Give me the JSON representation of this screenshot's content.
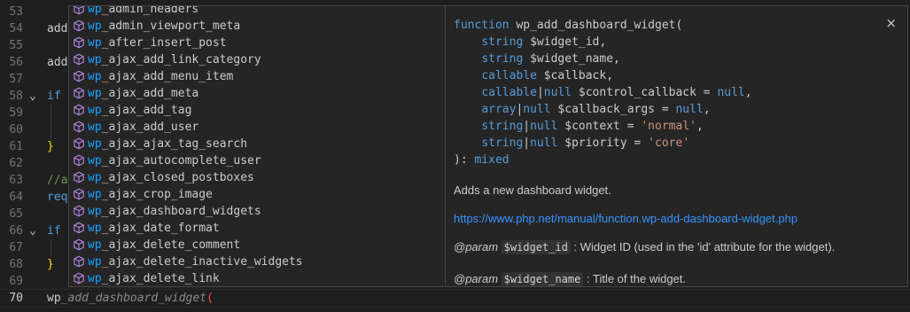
{
  "editor": {
    "lines": [
      {
        "num": "53",
        "code": ""
      },
      {
        "num": "54",
        "code": "add"
      },
      {
        "num": "55",
        "code": ""
      },
      {
        "num": "56",
        "code": "add"
      },
      {
        "num": "57",
        "code": ""
      },
      {
        "num": "58",
        "code": "if"
      },
      {
        "num": "59",
        "code": ""
      },
      {
        "num": "60",
        "code": ""
      },
      {
        "num": "61",
        "code": "}"
      },
      {
        "num": "62",
        "code": ""
      },
      {
        "num": "63",
        "code": "//a"
      },
      {
        "num": "64",
        "code": "req"
      },
      {
        "num": "65",
        "code": ""
      },
      {
        "num": "66",
        "code": "if"
      },
      {
        "num": "67",
        "code": ""
      },
      {
        "num": "68",
        "code": "}"
      },
      {
        "num": "69",
        "code": ""
      },
      {
        "num": "70",
        "code": "wp"
      }
    ],
    "current_line_ghost": "_add_dashboard_widget",
    "current_line_bracket": "("
  },
  "suggest": {
    "typed_prefix": "wp",
    "items": [
      "wp_admin_headers",
      "wp_admin_viewport_meta",
      "wp_after_insert_post",
      "wp_ajax_add_link_category",
      "wp_ajax_add_menu_item",
      "wp_ajax_add_meta",
      "wp_ajax_add_tag",
      "wp_ajax_add_user",
      "wp_ajax_ajax_tag_search",
      "wp_ajax_autocomplete_user",
      "wp_ajax_closed_postboxes",
      "wp_ajax_crop_image",
      "wp_ajax_dashboard_widgets",
      "wp_ajax_date_format",
      "wp_ajax_delete_comment",
      "wp_ajax_delete_inactive_widgets",
      "wp_ajax_delete_link"
    ]
  },
  "details": {
    "close_label": "×",
    "signature": {
      "keyword": "function",
      "name": "wp_add_dashboard_widget(",
      "params": [
        {
          "type": "string",
          "nullable": "",
          "var": "$widget_id",
          "default": "",
          "end": ","
        },
        {
          "type": "string",
          "nullable": "",
          "var": "$widget_name",
          "default": "",
          "end": ","
        },
        {
          "type": "callable",
          "nullable": "",
          "var": "$callback",
          "default": "",
          "end": ","
        },
        {
          "type": "callable",
          "nullable": "|null",
          "var": "$control_callback",
          "default": "null",
          "end": ","
        },
        {
          "type": "array",
          "nullable": "|null",
          "var": "$callback_args",
          "default": "null",
          "end": ","
        },
        {
          "type": "string",
          "nullable": "|null",
          "var": "$context",
          "default": "'normal'",
          "end": ","
        },
        {
          "type": "string",
          "nullable": "|null",
          "var": "$priority",
          "default": "'core'",
          "end": ""
        }
      ],
      "closing": "): ",
      "return_type": "mixed"
    },
    "description": "Adds a new dashboard widget.",
    "link": "https://www.php.net/manual/function.wp-add-dashboard-widget.php",
    "params_doc": [
      {
        "tag": "@param",
        "name": "$widget_id",
        "text": ": Widget ID (used in the 'id' attribute for the widget)."
      },
      {
        "tag": "@param",
        "name": "$widget_name",
        "text": ": Title of the widget."
      }
    ]
  },
  "colors": {
    "background": "#1f1f1f",
    "widget_bg": "#252526",
    "highlight": "#18a3ff",
    "keyword": "#569cd6",
    "string": "#ce9178",
    "link": "#3794ff",
    "icon": "#b180d7"
  },
  "icons": {
    "suggest_item": "symbol-function-cube-icon",
    "fold_open": "chevron-down-icon",
    "close": "close-icon"
  }
}
